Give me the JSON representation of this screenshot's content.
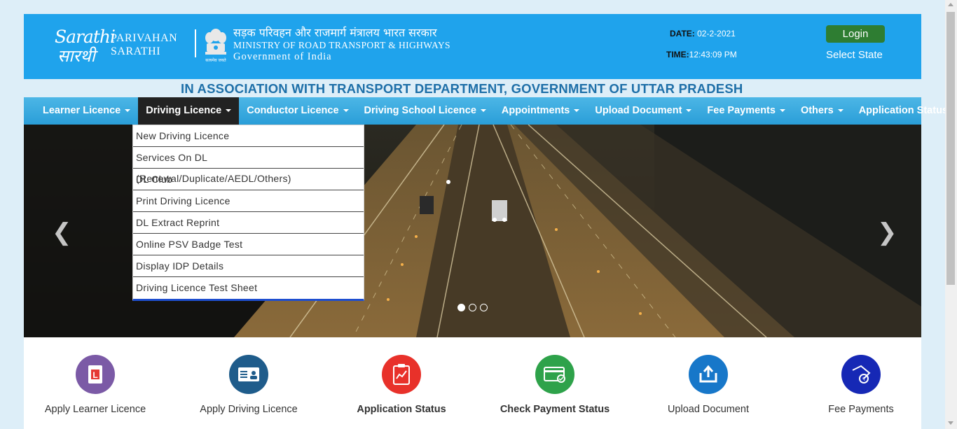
{
  "header": {
    "logo_text_1": "Sarathi",
    "logo_text_2": "सारथी",
    "brand_line1": "PARIVAHAN",
    "brand_line2": "SARATHI",
    "ministry_hindi": "सड़क परिवहन और राजमार्ग मंत्रालय भारत सरकार",
    "ministry_english": "MINISTRY OF ROAD TRANSPORT & HIGHWAYS",
    "government": "Government of India",
    "date_label": "DATE:",
    "date_value": "02-2-2021",
    "time_label": "TIME:",
    "time_value": "12:43:09 PM",
    "login_label": "Login",
    "select_state_label": "Select State"
  },
  "association_banner": "IN ASSOCIATION WITH TRANSPORT DEPARTMENT, GOVERNMENT OF UTTAR PRADESH",
  "nav": {
    "items": [
      {
        "label": "Learner Licence",
        "dropdown": true
      },
      {
        "label": "Driving Licence",
        "dropdown": true,
        "active": true
      },
      {
        "label": "Conductor Licence",
        "dropdown": true
      },
      {
        "label": "Driving School Licence",
        "dropdown": true
      },
      {
        "label": "Appointments",
        "dropdown": true
      },
      {
        "label": "Upload Document",
        "dropdown": true
      },
      {
        "label": "Fee Payments",
        "dropdown": true
      },
      {
        "label": "Others",
        "dropdown": true
      },
      {
        "label": "Application Status",
        "dropdown": false
      }
    ]
  },
  "driving_licence_menu": [
    "New Driving Licence",
    "Services On DL (Renewal/Duplicate/AEDL/Others)",
    "DL Club",
    "Print Driving Licence",
    "DL Extract Reprint",
    "Online PSV Badge Test",
    "Display IDP Details",
    "Driving Licence Test Sheet"
  ],
  "carousel": {
    "prev_icon": "chevron-left-icon",
    "next_icon": "chevron-right-icon",
    "slide_count": 3,
    "active_slide": 1
  },
  "services": [
    {
      "label": "Apply Learner Licence",
      "icon": "learner-licence-icon",
      "color": "#7b5aa6",
      "bold": false
    },
    {
      "label": "Apply Driving Licence",
      "icon": "driving-licence-card-icon",
      "color": "#1f5c8b",
      "bold": false
    },
    {
      "label": "Application Status",
      "icon": "clipboard-icon",
      "color": "#e8312a",
      "bold": true
    },
    {
      "label": "Check Payment Status",
      "icon": "payment-card-icon",
      "color": "#2ea24a",
      "bold": true
    },
    {
      "label": "Upload Document",
      "icon": "upload-icon",
      "color": "#1777c9",
      "bold": false
    },
    {
      "label": "Fee Payments",
      "icon": "hand-coin-icon",
      "color": "#1628b5",
      "bold": false
    }
  ],
  "colors": {
    "header_bg": "#1fa3ec",
    "nav_bg": "#2a9ed8",
    "login_bg": "#2e7d32",
    "banner_text": "#1e6fa8"
  }
}
